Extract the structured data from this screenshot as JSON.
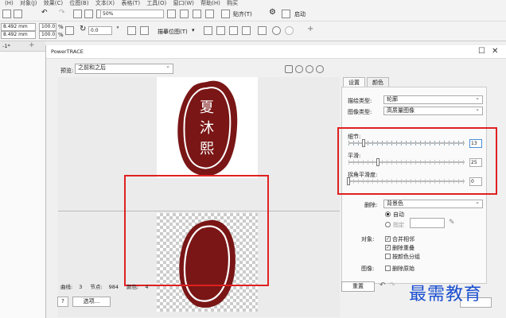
{
  "menubar": {
    "items": [
      "(H)",
      "对象(J)",
      "效果(C)",
      "位图(B)",
      "文本(X)",
      "表格(T)",
      "工具(O)",
      "窗口(W)",
      "帮助(H)",
      "购买"
    ]
  },
  "toolbar1": {
    "zoom": "50%",
    "snap_label": "贴齐(T)",
    "launch_label": "启动"
  },
  "toolbar2": {
    "width": "8.492 mm",
    "height": "8.492 mm",
    "scale_x": "100.0",
    "scale_y": "100.0",
    "percent": "%",
    "rotation": "0.0",
    "trace_label": "描摹位图(T)"
  },
  "doc_tab": {
    "label": "-1*"
  },
  "dialog": {
    "title": "PowerTRACE",
    "preview_label": "预览:",
    "preview_mode": "之前和之后",
    "stamp_text": [
      "夏",
      "沐",
      "熙"
    ],
    "stats": {
      "curves_label": "曲线:",
      "curves_value": "3",
      "nodes_label": "节点:",
      "nodes_value": "984",
      "colors_label": "颜色:",
      "colors_value": "4"
    },
    "help_label": "?",
    "options_label": "选项...",
    "reset_label": "重置",
    "tabs": [
      "设置",
      "颜色"
    ],
    "trace_type_label": "描绘类型:",
    "trace_type_value": "轮廓",
    "image_type_label": "图像类型:",
    "image_type_value": "高质量图像",
    "detail_label": "细节:",
    "detail_value": "13",
    "smoothing_label": "平滑:",
    "smoothing_value": "25",
    "corner_label": "拐角平滑度:",
    "corner_value": "0",
    "remove_label": "删除:",
    "remove_value": "背景色",
    "auto_label": "自动",
    "specify_label": "指定",
    "objects_label": "对象:",
    "merge_label": "合并相邻",
    "delete_overlap_label": "删除重叠",
    "group_by_color_label": "按颜色分组",
    "image_label": "图像:",
    "delete_original_label": "删除原始"
  },
  "slider_levels": {
    "detail": 0.13,
    "smoothing": 0.25,
    "corner": 0.0
  },
  "colors": {
    "stamp": "#7a1616",
    "highlight": "#e02020",
    "watermark": "#1a4fd0"
  },
  "watermark": "最需教育"
}
